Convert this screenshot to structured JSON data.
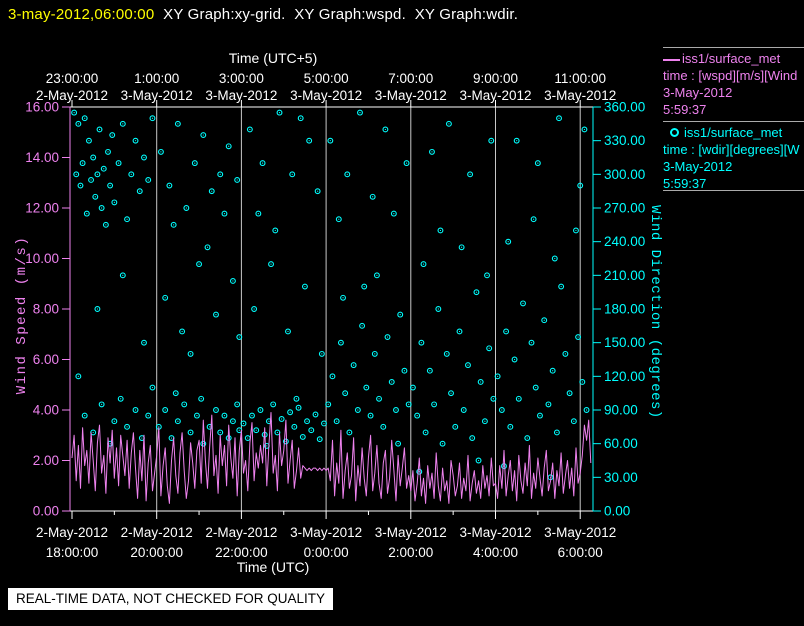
{
  "title_bar": {
    "timestamp": "3-may-2012,06:00:00",
    "graphs": "  XY Graph:xy-grid.  XY Graph:wspd.  XY Graph:wdir."
  },
  "legend": {
    "entries": [
      {
        "marker": "line",
        "color": "#ee82ee",
        "name": "iss1/surface_met",
        "field": "time : [wspd][m/s][Wind",
        "date": "3-May-2012",
        "time": "5:59:37"
      },
      {
        "marker": "circle",
        "color": "#00ffff",
        "name": "iss1/surface_met",
        "field": "time : [wdir][degrees][W",
        "date": "3-May-2012",
        "time": "5:59:37"
      }
    ]
  },
  "banner": {
    "text": "REAL-TIME DATA, NOT CHECKED FOR QUALITY"
  },
  "chart_data": {
    "type": "line+scatter",
    "colors": {
      "wspd": "#ee82ee",
      "wdir": "#00ffff",
      "grid": "#c8c8c8",
      "axis": "#ffffff",
      "background": "#000000",
      "title_date": "#ffff00"
    },
    "grid": "vertical-major-2h",
    "x_axis_top": {
      "label": "Time (UTC+5)",
      "ticks": [
        {
          "time": "23:00:00",
          "date": "2-May-2012"
        },
        {
          "time": "1:00:00",
          "date": "3-May-2012"
        },
        {
          "time": "3:00:00",
          "date": "3-May-2012"
        },
        {
          "time": "5:00:00",
          "date": "3-May-2012"
        },
        {
          "time": "7:00:00",
          "date": "3-May-2012"
        },
        {
          "time": "9:00:00",
          "date": "3-May-2012"
        },
        {
          "time": "11:00:00",
          "date": "3-May-2012"
        }
      ]
    },
    "x_axis_bottom": {
      "label": "Time (UTC)",
      "ticks": [
        {
          "date": "2-May-2012",
          "time": "18:00:00"
        },
        {
          "date": "2-May-2012",
          "time": "20:00:00"
        },
        {
          "date": "2-May-2012",
          "time": "22:00:00"
        },
        {
          "date": "3-May-2012",
          "time": "0:00:00"
        },
        {
          "date": "3-May-2012",
          "time": "2:00:00"
        },
        {
          "date": "3-May-2012",
          "time": "4:00:00"
        },
        {
          "date": "3-May-2012",
          "time": "6:00:00"
        }
      ]
    },
    "y_axis_left": {
      "label": "Wind Speed (m/s)",
      "color": "#ee82ee",
      "min": 0,
      "max": 16,
      "tick_step": 2,
      "tick_labels": [
        "16.00",
        "14.00",
        "12.00",
        "10.00",
        "8.00",
        "6.00",
        "4.00",
        "2.00",
        "0.00"
      ]
    },
    "y_axis_right": {
      "label": "Wind Direction (degrees)",
      "color": "#00ffff",
      "min": 0,
      "max": 360,
      "tick_step": 30,
      "tick_labels": [
        "360.00",
        "330.00",
        "300.00",
        "270.00",
        "240.00",
        "210.00",
        "180.00",
        "150.00",
        "120.00",
        "90.00",
        "60.00",
        "30.00",
        "0.00"
      ]
    },
    "x_range_hours_utc": [
      18.0,
      30.3
    ],
    "series": [
      {
        "name": "wspd",
        "type": "line",
        "units": "m/s",
        "color": "#ee82ee",
        "t0": 18.0,
        "dt": 0.05,
        "values": [
          2.1,
          3.0,
          1.2,
          2.6,
          0.9,
          3.3,
          1.8,
          2.4,
          1.1,
          3.1,
          2.0,
          0.8,
          2.7,
          3.4,
          1.5,
          2.2,
          0.7,
          2.9,
          1.9,
          3.2,
          1.3,
          2.5,
          1.0,
          3.0,
          2.2,
          1.4,
          2.8,
          0.9,
          2.3,
          3.1,
          1.7,
          0.5,
          2.4,
          1.2,
          3.0,
          0.4,
          1.9,
          2.6,
          0.8,
          1.5,
          2.2,
          3.3,
          0.6,
          1.8,
          2.5,
          1.0,
          0.3,
          2.0,
          2.9,
          1.4,
          0.7,
          2.3,
          3.1,
          1.6,
          0.5,
          1.2,
          2.7,
          1.9,
          0.9,
          2.4,
          2.8,
          1.1,
          3.6,
          2.0,
          0.9,
          2.5,
          3.8,
          1.4,
          2.2,
          0.7,
          3.0,
          1.8,
          2.6,
          1.0,
          3.4,
          2.1,
          1.3,
          2.9,
          0.6,
          2.4,
          3.2,
          1.5,
          2.0,
          0.8,
          2.7,
          3.5,
          1.2,
          2.3,
          1.7,
          2.6,
          1.9,
          3.3,
          1.0,
          2.6,
          3.9,
          1.5,
          2.2,
          0.8,
          3.1,
          1.8,
          2.4,
          3.6,
          1.1,
          2.0,
          2.8,
          0.9,
          1.6,
          2.5,
          1.3,
          1.8,
          1.7,
          1.6,
          1.7,
          1.6,
          1.7,
          1.7,
          1.6,
          1.7,
          1.6,
          1.7,
          1.6,
          1.7,
          1.2,
          2.8,
          0.6,
          1.9,
          1.1,
          3.2,
          0.5,
          1.6,
          2.3,
          0.9,
          1.4,
          2.9,
          0.4,
          1.8,
          1.0,
          2.5,
          1.3,
          0.6,
          2.1,
          3.0,
          0.8,
          1.5,
          2.6,
          1.1,
          0.5,
          1.9,
          2.4,
          0.7,
          1.3,
          2.8,
          1.6,
          0.4,
          2.2,
          1.0,
          1.7,
          2.5,
          0.9,
          1.4,
          0.8,
          1.6,
          0.4,
          1.1,
          2.1,
          0.6,
          1.3,
          0.3,
          1.8,
          0.9,
          1.5,
          0.5,
          2.3,
          1.0,
          0.4,
          1.7,
          0.8,
          1.2,
          0.3,
          2.0,
          1.4,
          0.6,
          1.0,
          1.9,
          0.5,
          1.3,
          0.8,
          2.2,
          0.4,
          1.1,
          1.6,
          0.7,
          1.2,
          0.5,
          1.8,
          0.9,
          1.4,
          0.6,
          2.1,
          1.0,
          1.1,
          0.5,
          1.8,
          0.9,
          2.4,
          0.6,
          1.4,
          2.0,
          0.8,
          1.6,
          0.4,
          2.2,
          1.2,
          0.7,
          1.9,
          1.0,
          2.6,
          0.5,
          1.5,
          0.9,
          2.1,
          1.3,
          0.6,
          1.7,
          2.4,
          0.8,
          1.2,
          1.9,
          0.5,
          1.6,
          1.0,
          2.3,
          0.7,
          1.4,
          2.0,
          0.9,
          1.7,
          0.6,
          2.5,
          1.1,
          1.5,
          2.2,
          3.4,
          2.8,
          3.6,
          1.9
        ]
      },
      {
        "name": "wdir",
        "type": "scatter",
        "units": "degrees",
        "color": "#00ffff",
        "points": [
          [
            18.05,
            355
          ],
          [
            18.1,
            300
          ],
          [
            18.15,
            345
          ],
          [
            18.2,
            290
          ],
          [
            18.25,
            310
          ],
          [
            18.3,
            350
          ],
          [
            18.35,
            265
          ],
          [
            18.4,
            330
          ],
          [
            18.45,
            295
          ],
          [
            18.5,
            315
          ],
          [
            18.55,
            280
          ],
          [
            18.6,
            300
          ],
          [
            18.65,
            340
          ],
          [
            18.7,
            270
          ],
          [
            18.75,
            305
          ],
          [
            18.8,
            255
          ],
          [
            18.85,
            320
          ],
          [
            18.9,
            290
          ],
          [
            18.95,
            335
          ],
          [
            19.0,
            275
          ],
          [
            19.1,
            310
          ],
          [
            19.2,
            345
          ],
          [
            19.3,
            260
          ],
          [
            19.4,
            300
          ],
          [
            19.5,
            330
          ],
          [
            19.6,
            285
          ],
          [
            19.7,
            315
          ],
          [
            19.8,
            295
          ],
          [
            19.9,
            350
          ],
          [
            18.3,
            85
          ],
          [
            18.5,
            70
          ],
          [
            18.7,
            95
          ],
          [
            18.9,
            60
          ],
          [
            19.0,
            80
          ],
          [
            19.15,
            100
          ],
          [
            19.3,
            75
          ],
          [
            19.5,
            90
          ],
          [
            19.65,
            65
          ],
          [
            19.8,
            85
          ],
          [
            19.9,
            110
          ],
          [
            18.15,
            120
          ],
          [
            18.6,
            180
          ],
          [
            19.2,
            210
          ],
          [
            19.7,
            150
          ],
          [
            20.1,
            320
          ],
          [
            20.3,
            290
          ],
          [
            20.5,
            345
          ],
          [
            20.7,
            270
          ],
          [
            20.9,
            310
          ],
          [
            21.1,
            335
          ],
          [
            21.3,
            285
          ],
          [
            21.5,
            300
          ],
          [
            21.7,
            325
          ],
          [
            21.9,
            295
          ],
          [
            20.4,
            255
          ],
          [
            21.6,
            265
          ],
          [
            20.2,
            190
          ],
          [
            20.6,
            160
          ],
          [
            21.0,
            220
          ],
          [
            21.4,
            175
          ],
          [
            21.8,
            205
          ],
          [
            20.8,
            140
          ],
          [
            21.2,
            235
          ],
          [
            21.95,
            155
          ],
          [
            20.05,
            75
          ],
          [
            20.2,
            90
          ],
          [
            20.35,
            65
          ],
          [
            20.5,
            80
          ],
          [
            20.65,
            95
          ],
          [
            20.8,
            70
          ],
          [
            20.95,
            85
          ],
          [
            21.1,
            60
          ],
          [
            21.25,
            75
          ],
          [
            21.4,
            90
          ],
          [
            21.5,
            70
          ],
          [
            21.6,
            85
          ],
          [
            21.7,
            65
          ],
          [
            21.8,
            80
          ],
          [
            21.9,
            95
          ],
          [
            21.95,
            72
          ],
          [
            20.45,
            105
          ],
          [
            21.05,
            100
          ],
          [
            22.05,
            78
          ],
          [
            22.15,
            65
          ],
          [
            22.25,
            85
          ],
          [
            22.35,
            72
          ],
          [
            22.45,
            90
          ],
          [
            22.55,
            68
          ],
          [
            22.65,
            80
          ],
          [
            22.75,
            95
          ],
          [
            22.85,
            70
          ],
          [
            22.95,
            82
          ],
          [
            23.05,
            62
          ],
          [
            23.15,
            88
          ],
          [
            23.25,
            75
          ],
          [
            23.35,
            92
          ],
          [
            23.45,
            66
          ],
          [
            23.55,
            80
          ],
          [
            23.65,
            72
          ],
          [
            23.75,
            86
          ],
          [
            23.85,
            64
          ],
          [
            23.95,
            78
          ],
          [
            23.3,
            100
          ],
          [
            22.6,
            58
          ],
          [
            22.2,
            340
          ],
          [
            22.5,
            310
          ],
          [
            22.9,
            355
          ],
          [
            23.2,
            300
          ],
          [
            23.6,
            330
          ],
          [
            23.8,
            285
          ],
          [
            22.4,
            265
          ],
          [
            23.4,
            350
          ],
          [
            22.3,
            180
          ],
          [
            22.7,
            220
          ],
          [
            23.1,
            160
          ],
          [
            23.5,
            200
          ],
          [
            23.9,
            140
          ],
          [
            22.8,
            250
          ],
          [
            24.05,
            95
          ],
          [
            24.15,
            120
          ],
          [
            24.25,
            80
          ],
          [
            24.35,
            150
          ],
          [
            24.45,
            105
          ],
          [
            24.55,
            70
          ],
          [
            24.65,
            130
          ],
          [
            24.75,
            90
          ],
          [
            24.85,
            165
          ],
          [
            24.95,
            110
          ],
          [
            25.05,
            85
          ],
          [
            25.15,
            140
          ],
          [
            25.25,
            100
          ],
          [
            25.35,
            75
          ],
          [
            25.45,
            155
          ],
          [
            25.55,
            115
          ],
          [
            25.65,
            90
          ],
          [
            25.75,
            175
          ],
          [
            25.85,
            125
          ],
          [
            25.95,
            95
          ],
          [
            24.4,
            190
          ],
          [
            25.2,
            210
          ],
          [
            25.7,
            60
          ],
          [
            24.9,
            200
          ],
          [
            24.1,
            330
          ],
          [
            24.5,
            300
          ],
          [
            24.8,
            355
          ],
          [
            25.1,
            280
          ],
          [
            25.4,
            340
          ],
          [
            25.9,
            310
          ],
          [
            24.3,
            260
          ],
          [
            25.6,
            265
          ],
          [
            26.05,
            110
          ],
          [
            26.15,
            85
          ],
          [
            26.25,
            150
          ],
          [
            26.35,
            70
          ],
          [
            26.45,
            125
          ],
          [
            26.55,
            95
          ],
          [
            26.65,
            180
          ],
          [
            26.75,
            60
          ],
          [
            26.85,
            140
          ],
          [
            26.95,
            105
          ],
          [
            27.05,
            75
          ],
          [
            27.15,
            160
          ],
          [
            27.25,
            90
          ],
          [
            27.35,
            130
          ],
          [
            27.45,
            65
          ],
          [
            27.55,
            195
          ],
          [
            27.65,
            115
          ],
          [
            27.75,
            80
          ],
          [
            27.85,
            145
          ],
          [
            27.95,
            100
          ],
          [
            26.3,
            220
          ],
          [
            26.7,
            250
          ],
          [
            27.2,
            235
          ],
          [
            27.8,
            210
          ],
          [
            26.5,
            320
          ],
          [
            26.9,
            345
          ],
          [
            27.4,
            300
          ],
          [
            27.9,
            330
          ],
          [
            26.2,
            35
          ],
          [
            27.6,
            45
          ],
          [
            28.05,
            120
          ],
          [
            28.15,
            90
          ],
          [
            28.25,
            160
          ],
          [
            28.35,
            75
          ],
          [
            28.45,
            135
          ],
          [
            28.55,
            100
          ],
          [
            28.65,
            185
          ],
          [
            28.75,
            65
          ],
          [
            28.85,
            150
          ],
          [
            28.95,
            110
          ],
          [
            29.05,
            85
          ],
          [
            29.15,
            170
          ],
          [
            29.25,
            95
          ],
          [
            29.35,
            125
          ],
          [
            29.45,
            70
          ],
          [
            29.55,
            200
          ],
          [
            29.65,
            140
          ],
          [
            29.75,
            105
          ],
          [
            29.85,
            80
          ],
          [
            29.95,
            155
          ],
          [
            30.05,
            115
          ],
          [
            30.15,
            90
          ],
          [
            28.3,
            240
          ],
          [
            28.9,
            260
          ],
          [
            29.4,
            225
          ],
          [
            29.9,
            250
          ],
          [
            28.5,
            330
          ],
          [
            29.0,
            310
          ],
          [
            29.5,
            350
          ],
          [
            30.0,
            290
          ],
          [
            28.2,
            40
          ],
          [
            29.3,
            30
          ],
          [
            30.1,
            340
          ]
        ]
      }
    ]
  }
}
